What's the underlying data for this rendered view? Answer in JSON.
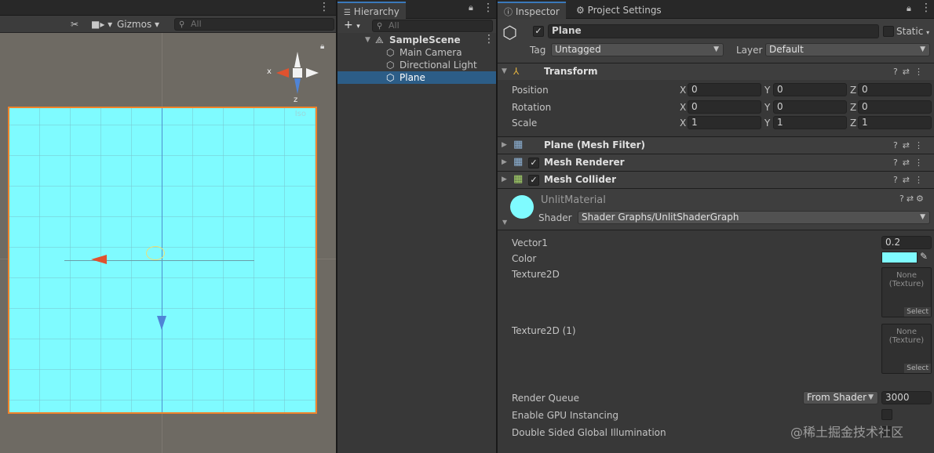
{
  "scene": {
    "toolbar": {
      "gizmos_label": "Gizmos",
      "search_placeholder": "All"
    },
    "orientation": {
      "x_label": "x",
      "z_label": "z",
      "persp_label": "Iso"
    },
    "colors": {
      "plane": "#7ffbff",
      "selection_outline": "#f0832b",
      "background": "#6e6a63"
    }
  },
  "hierarchy": {
    "tab_label": "Hierarchy",
    "add_label": "+",
    "search_placeholder": "All",
    "scene_name": "SampleScene",
    "items": [
      {
        "label": "Main Camera"
      },
      {
        "label": "Directional Light"
      },
      {
        "label": "Plane"
      }
    ],
    "selected": "Plane"
  },
  "inspector": {
    "tabs": [
      {
        "label": "Inspector"
      },
      {
        "label": "Project Settings"
      }
    ],
    "object_name": "Plane",
    "static_label": "Static",
    "tag_label": "Tag",
    "tag_value": "Untagged",
    "layer_label": "Layer",
    "layer_value": "Default",
    "transform": {
      "title": "Transform",
      "position": {
        "label": "Position",
        "x": "0",
        "y": "0",
        "z": "0"
      },
      "rotation": {
        "label": "Rotation",
        "x": "0",
        "y": "0",
        "z": "0"
      },
      "scale": {
        "label": "Scale",
        "x": "1",
        "y": "1",
        "z": "1"
      },
      "axis_x": "X",
      "axis_y": "Y",
      "axis_z": "Z"
    },
    "components": [
      {
        "title": "Plane (Mesh Filter)"
      },
      {
        "title": "Mesh Renderer"
      },
      {
        "title": "Mesh Collider"
      }
    ],
    "material": {
      "name": "UnlitMaterial",
      "shader_label": "Shader",
      "shader_value": "Shader Graphs/UnlitShaderGraph",
      "swatch_color": "#7ffbff",
      "props": {
        "vector1_label": "Vector1",
        "vector1_value": "0.2",
        "color_label": "Color",
        "tex1_label": "Texture2D",
        "tex2_label": "Texture2D (1)",
        "tex_none": "None",
        "tex_type": "(Texture)",
        "tex_select": "Select",
        "render_queue_label": "Render Queue",
        "render_queue_mode": "From Shader",
        "render_queue_value": "3000",
        "gpu_instancing_label": "Enable GPU Instancing",
        "double_sided_label": "Double Sided Global Illumination"
      }
    },
    "watermark": "@稀土掘金技术社区"
  }
}
